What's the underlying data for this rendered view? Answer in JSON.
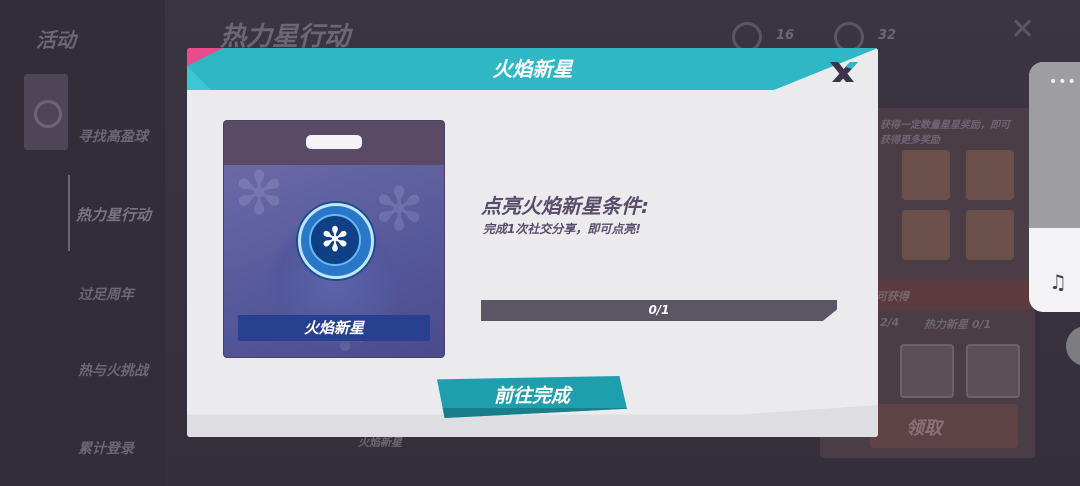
{
  "background": {
    "section_title": "活动",
    "page_title": "热力星行动",
    "currency_a": "16",
    "currency_b": "32",
    "left_menu": [
      "寻找高盈球",
      "热力星行动",
      "过足周年",
      "热与火挑战",
      "累计登录"
    ],
    "right_tip": "获得一定数量星星奖励，即可获得更多奖励",
    "right_row_label": "可获得",
    "right_progress_a": "2/4",
    "right_progress_b": "热力新星 0/1",
    "claim_label": "领取",
    "bottom_label": "火焰新星"
  },
  "dialog": {
    "title": "火焰新星",
    "close_icon": "close-x-icon",
    "badge_name": "火焰新星",
    "badge_icon": "snowflake-medal-icon",
    "condition_title": "点亮火焰新星条件:",
    "condition_desc": "完成1次社交分享，即可点亮!",
    "progress_text": "0/1",
    "progress_value": 0,
    "go_button": "前往完成"
  },
  "side_panel": {
    "more_icon": "more-dots-icon",
    "music_icon": "music-note-icon"
  },
  "colors": {
    "header_teal": "#2fb7c6",
    "accent_pink": "#ea4b8a",
    "button_teal": "#1f9fad",
    "card_purple": "#5b5278",
    "text_purple": "#5a4d6c"
  }
}
